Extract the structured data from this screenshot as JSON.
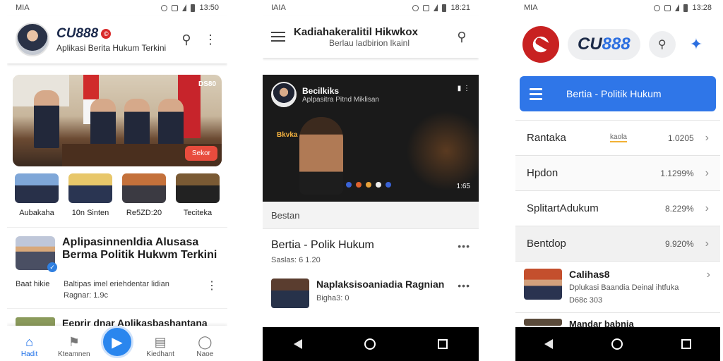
{
  "phone1": {
    "status": {
      "carrier": "MIA",
      "time": "13:50"
    },
    "header": {
      "brand": "CU888",
      "subtitle": "Aplikasi Berita Hukum Terkini"
    },
    "hero": {
      "tag": "DS80",
      "cta": "Sekor"
    },
    "categories": [
      {
        "label": "Aubakaha"
      },
      {
        "label": "10n Sinten"
      },
      {
        "label": "Re5ZD:20"
      },
      {
        "label": "Teciteka"
      }
    ],
    "article": {
      "title": "Aplipasinnenldia Alusasa Berma Politik Hukwm Terkini",
      "source": "Baat hikie",
      "line1": "Baltipas imel eriehdentar lidian",
      "line2": "Ragnar: 1.9c"
    },
    "next_title": "Eeprir dnar Aplikasbashantana",
    "nav": [
      {
        "label": "Hadit",
        "icon": "home-icon"
      },
      {
        "label": "Kteamnen",
        "icon": "pin-icon"
      },
      {
        "label": "Kiedhant",
        "icon": "news-icon"
      },
      {
        "label": "Naoe",
        "icon": "info-icon"
      }
    ]
  },
  "phone2": {
    "status": {
      "carrier": "IAIA",
      "time": "18:21"
    },
    "header": {
      "title": "Kadiahakeralitil Hikwkox",
      "subtitle": "Berlau ladbirion lkainl"
    },
    "video": {
      "channel": "Becilkiks",
      "channel_sub": "Aplpasitra Pitnd Miklisan",
      "label": "Bkvka",
      "time": "1:65"
    },
    "section_label": "Bestan",
    "item1": {
      "title": "Bertia - Polik Hukum",
      "meta": "Saslas: 6 1.20"
    },
    "item2": {
      "title": "Naplaksisoaniadia Ragnian",
      "meta": "Bigha3: 0"
    }
  },
  "phone3": {
    "status": {
      "carrier": "MIA",
      "time": "13:28"
    },
    "header": {
      "brand_a": "CU",
      "brand_b": "888"
    },
    "banner": {
      "label": "Bertia - Politik Hukum"
    },
    "rows": [
      {
        "name": "Rantaka",
        "mid": "kaola",
        "value": "1.0205"
      },
      {
        "name": "Hpdon",
        "mid": "",
        "value": "1.1299%"
      },
      {
        "name": "SplitartAdukum",
        "mid": "",
        "value": "8.229%"
      },
      {
        "name": "Bentdop",
        "mid": "",
        "value": "9.920%"
      }
    ],
    "card": {
      "title": "Calihas8",
      "line1": "Dplukasi Baandia Deinal ihtfuka",
      "line2": "D68c 303"
    },
    "peek_title": "Mandar babnia"
  },
  "colors": {
    "accent_blue": "#2f76e8",
    "brand_red": "#c82121"
  }
}
